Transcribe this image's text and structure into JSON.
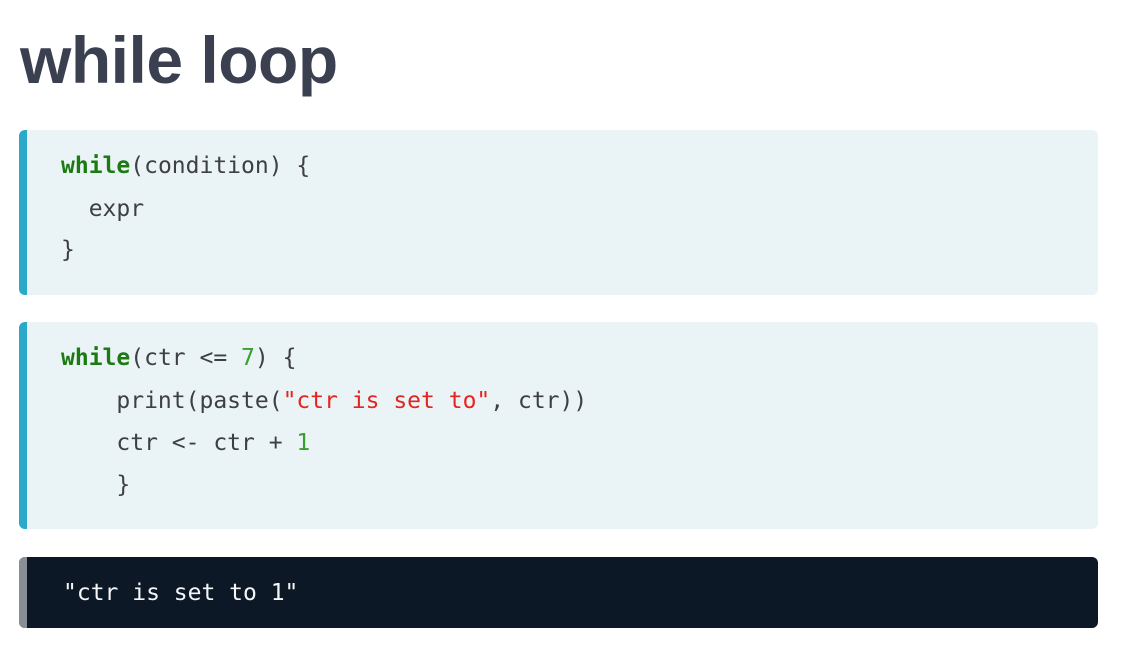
{
  "heading": "while loop",
  "syntax_block": {
    "line1_keyword": "while",
    "line1_rest": "(condition) {",
    "line2": "  expr",
    "line3": "}"
  },
  "example_block": {
    "line1_keyword": "while",
    "line1_a": "(ctr <= ",
    "line1_num": "7",
    "line1_b": ") {",
    "line2_a": "    print(paste(",
    "line2_str": "\"ctr is set to\"",
    "line2_b": ", ctr))",
    "line3_a": "    ctr <- ctr + ",
    "line3_num": "1",
    "line4": "    }"
  },
  "output_block": {
    "line1": "\"ctr is set to 1\""
  },
  "colors": {
    "title": "#3b4051",
    "code_bg": "#eaf3f6",
    "code_accent": "#2aa9c9",
    "output_bg": "#0d1826",
    "output_accent": "#8a8f96",
    "keyword": "#1d7a12",
    "number": "#3aa02d",
    "string": "#e4251f"
  }
}
